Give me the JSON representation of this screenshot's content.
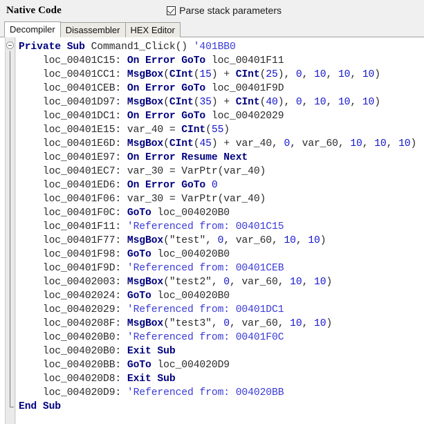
{
  "header": {
    "title": "Native Code",
    "checkbox": {
      "label": "Parse stack parameters",
      "checked": "true",
      "icon": "checkmark-icon"
    }
  },
  "tabs": [
    {
      "label": "Decompiler",
      "active": "true"
    },
    {
      "label": "Disassembler",
      "active": "false"
    },
    {
      "label": "HEX Editor",
      "active": "false"
    }
  ],
  "colors": {
    "keyword": "#000080",
    "number": "#1414cc",
    "comment": "#3a3ad6",
    "plain": "#2a2a2a",
    "pane_bg": "#ffffff",
    "chrome_bg": "#f0f0f0",
    "tab_inactive_bg": "#eceae4",
    "border": "#a0a0a0"
  },
  "editor": {
    "fold_marker": "collapse-icon",
    "language": "Visual Basic decompiled pseudocode",
    "lines": [
      {
        "indent": 0,
        "tokens": [
          {
            "t": "Private Sub ",
            "c": "kw"
          },
          {
            "t": "Command1_Click() ",
            "c": "plain"
          },
          {
            "t": "'401BB0",
            "c": "cmt"
          }
        ]
      },
      {
        "indent": 1,
        "tokens": [
          {
            "t": "loc_00401C15: ",
            "c": "plain"
          },
          {
            "t": "On Error GoTo ",
            "c": "kw"
          },
          {
            "t": "loc_00401F11",
            "c": "plain"
          }
        ]
      },
      {
        "indent": 1,
        "tokens": [
          {
            "t": "loc_00401CC1: ",
            "c": "plain"
          },
          {
            "t": "MsgBox",
            "c": "kw"
          },
          {
            "t": "(",
            "c": "plain"
          },
          {
            "t": "CInt",
            "c": "kw"
          },
          {
            "t": "(",
            "c": "plain"
          },
          {
            "t": "15",
            "c": "num"
          },
          {
            "t": ") + ",
            "c": "plain"
          },
          {
            "t": "CInt",
            "c": "kw"
          },
          {
            "t": "(",
            "c": "plain"
          },
          {
            "t": "25",
            "c": "num"
          },
          {
            "t": "), ",
            "c": "plain"
          },
          {
            "t": "0",
            "c": "num"
          },
          {
            "t": ", ",
            "c": "plain"
          },
          {
            "t": "10",
            "c": "num"
          },
          {
            "t": ", ",
            "c": "plain"
          },
          {
            "t": "10",
            "c": "num"
          },
          {
            "t": ", ",
            "c": "plain"
          },
          {
            "t": "10",
            "c": "num"
          },
          {
            "t": ")",
            "c": "plain"
          }
        ]
      },
      {
        "indent": 1,
        "tokens": [
          {
            "t": "loc_00401CEB: ",
            "c": "plain"
          },
          {
            "t": "On Error GoTo ",
            "c": "kw"
          },
          {
            "t": "loc_00401F9D",
            "c": "plain"
          }
        ]
      },
      {
        "indent": 1,
        "tokens": [
          {
            "t": "loc_00401D97: ",
            "c": "plain"
          },
          {
            "t": "MsgBox",
            "c": "kw"
          },
          {
            "t": "(",
            "c": "plain"
          },
          {
            "t": "CInt",
            "c": "kw"
          },
          {
            "t": "(",
            "c": "plain"
          },
          {
            "t": "35",
            "c": "num"
          },
          {
            "t": ") + ",
            "c": "plain"
          },
          {
            "t": "CInt",
            "c": "kw"
          },
          {
            "t": "(",
            "c": "plain"
          },
          {
            "t": "40",
            "c": "num"
          },
          {
            "t": "), ",
            "c": "plain"
          },
          {
            "t": "0",
            "c": "num"
          },
          {
            "t": ", ",
            "c": "plain"
          },
          {
            "t": "10",
            "c": "num"
          },
          {
            "t": ", ",
            "c": "plain"
          },
          {
            "t": "10",
            "c": "num"
          },
          {
            "t": ", ",
            "c": "plain"
          },
          {
            "t": "10",
            "c": "num"
          },
          {
            "t": ")",
            "c": "plain"
          }
        ]
      },
      {
        "indent": 1,
        "tokens": [
          {
            "t": "loc_00401DC1: ",
            "c": "plain"
          },
          {
            "t": "On Error GoTo ",
            "c": "kw"
          },
          {
            "t": "loc_00402029",
            "c": "plain"
          }
        ]
      },
      {
        "indent": 1,
        "tokens": [
          {
            "t": "loc_00401E15: var_40 = ",
            "c": "plain"
          },
          {
            "t": "CInt",
            "c": "kw"
          },
          {
            "t": "(",
            "c": "plain"
          },
          {
            "t": "55",
            "c": "num"
          },
          {
            "t": ")",
            "c": "plain"
          }
        ]
      },
      {
        "indent": 1,
        "tokens": [
          {
            "t": "loc_00401E6D: ",
            "c": "plain"
          },
          {
            "t": "MsgBox",
            "c": "kw"
          },
          {
            "t": "(",
            "c": "plain"
          },
          {
            "t": "CInt",
            "c": "kw"
          },
          {
            "t": "(",
            "c": "plain"
          },
          {
            "t": "45",
            "c": "num"
          },
          {
            "t": ") + var_40, ",
            "c": "plain"
          },
          {
            "t": "0",
            "c": "num"
          },
          {
            "t": ", var_60, ",
            "c": "plain"
          },
          {
            "t": "10",
            "c": "num"
          },
          {
            "t": ", ",
            "c": "plain"
          },
          {
            "t": "10",
            "c": "num"
          },
          {
            "t": ", ",
            "c": "plain"
          },
          {
            "t": "10",
            "c": "num"
          },
          {
            "t": ")",
            "c": "plain"
          }
        ]
      },
      {
        "indent": 1,
        "tokens": [
          {
            "t": "loc_00401E97: ",
            "c": "plain"
          },
          {
            "t": "On Error Resume Next",
            "c": "kw"
          }
        ]
      },
      {
        "indent": 1,
        "tokens": [
          {
            "t": "loc_00401EC7: var_30 = VarPtr(var_40)",
            "c": "plain"
          }
        ]
      },
      {
        "indent": 1,
        "tokens": [
          {
            "t": "loc_00401ED6: ",
            "c": "plain"
          },
          {
            "t": "On Error GoTo ",
            "c": "kw"
          },
          {
            "t": "0",
            "c": "num"
          }
        ]
      },
      {
        "indent": 1,
        "tokens": [
          {
            "t": "loc_00401F06: var_30 = VarPtr(var_40)",
            "c": "plain"
          }
        ]
      },
      {
        "indent": 1,
        "tokens": [
          {
            "t": "loc_00401F0C: ",
            "c": "plain"
          },
          {
            "t": "GoTo ",
            "c": "kw"
          },
          {
            "t": "loc_004020B0",
            "c": "plain"
          }
        ]
      },
      {
        "indent": 1,
        "tokens": [
          {
            "t": "loc_00401F11: ",
            "c": "plain"
          },
          {
            "t": "'Referenced from: 00401C15",
            "c": "cmt"
          }
        ]
      },
      {
        "indent": 1,
        "tokens": [
          {
            "t": "loc_00401F77: ",
            "c": "plain"
          },
          {
            "t": "MsgBox",
            "c": "kw"
          },
          {
            "t": "(\"test\", ",
            "c": "plain"
          },
          {
            "t": "0",
            "c": "num"
          },
          {
            "t": ", var_60, ",
            "c": "plain"
          },
          {
            "t": "10",
            "c": "num"
          },
          {
            "t": ", ",
            "c": "plain"
          },
          {
            "t": "10",
            "c": "num"
          },
          {
            "t": ")",
            "c": "plain"
          }
        ]
      },
      {
        "indent": 1,
        "tokens": [
          {
            "t": "loc_00401F98: ",
            "c": "plain"
          },
          {
            "t": "GoTo ",
            "c": "kw"
          },
          {
            "t": "loc_004020B0",
            "c": "plain"
          }
        ]
      },
      {
        "indent": 1,
        "tokens": [
          {
            "t": "loc_00401F9D: ",
            "c": "plain"
          },
          {
            "t": "'Referenced from: 00401CEB",
            "c": "cmt"
          }
        ]
      },
      {
        "indent": 1,
        "tokens": [
          {
            "t": "loc_00402003: ",
            "c": "plain"
          },
          {
            "t": "MsgBox",
            "c": "kw"
          },
          {
            "t": "(\"test2\", ",
            "c": "plain"
          },
          {
            "t": "0",
            "c": "num"
          },
          {
            "t": ", var_60, ",
            "c": "plain"
          },
          {
            "t": "10",
            "c": "num"
          },
          {
            "t": ", ",
            "c": "plain"
          },
          {
            "t": "10",
            "c": "num"
          },
          {
            "t": ")",
            "c": "plain"
          }
        ]
      },
      {
        "indent": 1,
        "tokens": [
          {
            "t": "loc_00402024: ",
            "c": "plain"
          },
          {
            "t": "GoTo ",
            "c": "kw"
          },
          {
            "t": "loc_004020B0",
            "c": "plain"
          }
        ]
      },
      {
        "indent": 1,
        "tokens": [
          {
            "t": "loc_00402029: ",
            "c": "plain"
          },
          {
            "t": "'Referenced from: 00401DC1",
            "c": "cmt"
          }
        ]
      },
      {
        "indent": 1,
        "tokens": [
          {
            "t": "loc_0040208F: ",
            "c": "plain"
          },
          {
            "t": "MsgBox",
            "c": "kw"
          },
          {
            "t": "(\"test3\", ",
            "c": "plain"
          },
          {
            "t": "0",
            "c": "num"
          },
          {
            "t": ", var_60, ",
            "c": "plain"
          },
          {
            "t": "10",
            "c": "num"
          },
          {
            "t": ", ",
            "c": "plain"
          },
          {
            "t": "10",
            "c": "num"
          },
          {
            "t": ")",
            "c": "plain"
          }
        ]
      },
      {
        "indent": 1,
        "tokens": [
          {
            "t": "loc_004020B0: ",
            "c": "plain"
          },
          {
            "t": "'Referenced from: 00401F0C",
            "c": "cmt"
          }
        ]
      },
      {
        "indent": 1,
        "tokens": [
          {
            "t": "loc_004020B0: ",
            "c": "plain"
          },
          {
            "t": "Exit Sub",
            "c": "kw"
          }
        ]
      },
      {
        "indent": 1,
        "tokens": [
          {
            "t": "loc_004020BB: ",
            "c": "plain"
          },
          {
            "t": "GoTo ",
            "c": "kw"
          },
          {
            "t": "loc_004020D9",
            "c": "plain"
          }
        ]
      },
      {
        "indent": 1,
        "tokens": [
          {
            "t": "loc_004020D8: ",
            "c": "plain"
          },
          {
            "t": "Exit Sub",
            "c": "kw"
          }
        ]
      },
      {
        "indent": 1,
        "tokens": [
          {
            "t": "loc_004020D9: ",
            "c": "plain"
          },
          {
            "t": "'Referenced from: 004020BB",
            "c": "cmt"
          }
        ]
      },
      {
        "indent": 0,
        "tokens": [
          {
            "t": "End Sub",
            "c": "kw"
          }
        ]
      }
    ]
  }
}
